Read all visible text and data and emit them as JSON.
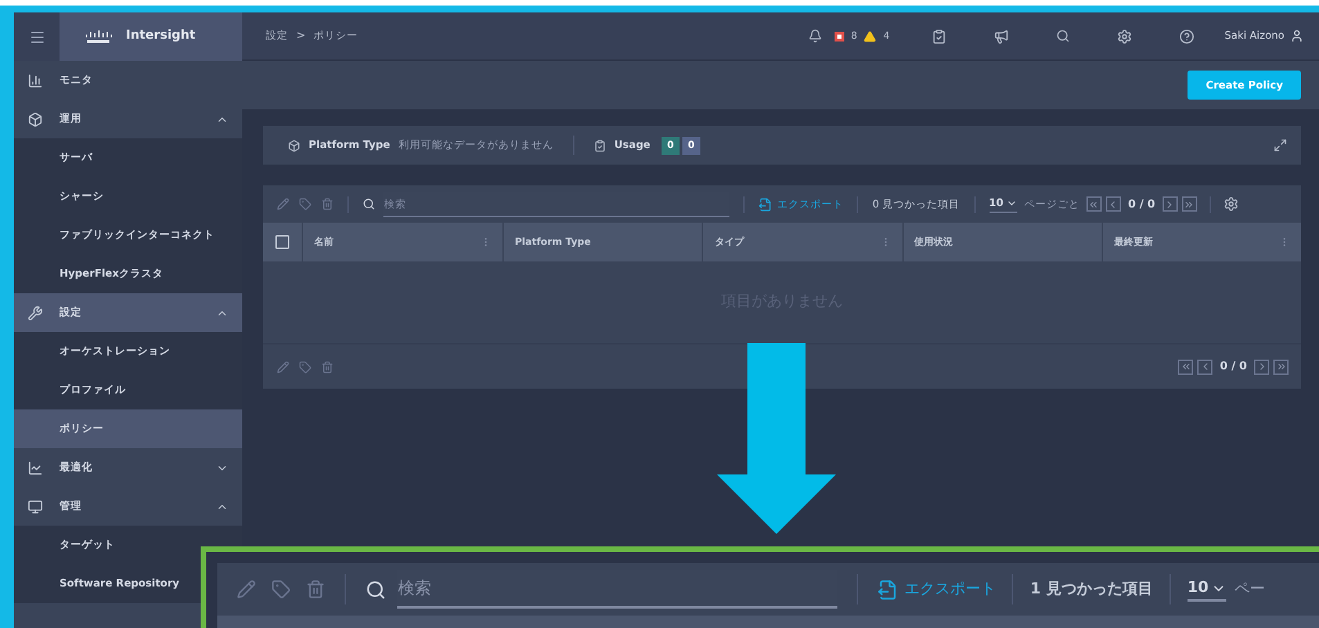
{
  "topbar": {
    "brand": "Intersight",
    "breadcrumb": [
      "設定",
      "ポリシー"
    ],
    "separator": ">",
    "critical_count": "8",
    "warning_count": "4",
    "user": "Saki Aizono"
  },
  "sidebar": {
    "items": [
      {
        "label": "モニタ",
        "selected": false
      },
      {
        "label": "運用",
        "selected": false,
        "expanded": true,
        "children": [
          {
            "label": "サーバ",
            "selected": false
          },
          {
            "label": "シャーシ",
            "selected": false
          },
          {
            "label": "ファブリックインターコネクト",
            "selected": false
          },
          {
            "label": "HyperFlexクラスタ",
            "selected": false
          }
        ]
      },
      {
        "label": "設定",
        "selected": true,
        "expanded": true,
        "children": [
          {
            "label": "オーケストレーション",
            "selected": false
          },
          {
            "label": "プロファイル",
            "selected": false
          },
          {
            "label": "ポリシー",
            "selected": true
          }
        ]
      },
      {
        "label": "最適化",
        "selected": false,
        "expanded": false
      },
      {
        "label": "管理",
        "selected": false,
        "expanded": true,
        "children": [
          {
            "label": "ターゲット",
            "selected": false
          },
          {
            "label": "Software Repository",
            "selected": false
          }
        ]
      }
    ]
  },
  "create_button": "Create Policy",
  "summary": {
    "platform_label": "Platform Type",
    "platform_value": "利用可能なデータがありません",
    "usage_label": "Usage",
    "usage_badges": [
      {
        "text": "0",
        "color": "#2f7a78"
      },
      {
        "text": "0",
        "color": "#56648a"
      }
    ]
  },
  "table": {
    "select_all_checked": false,
    "search_placeholder": "検索",
    "export": "エクスポート",
    "count": "0 見つかった項目",
    "page_size": "10",
    "per_page": "ページごと",
    "page": "0 / 0",
    "columns": [
      {
        "label": "名前",
        "menu": true
      },
      {
        "label": "Platform Type",
        "menu": false
      },
      {
        "label": "タイプ",
        "menu": true
      },
      {
        "label": "使用状況",
        "menu": false
      },
      {
        "label": "最終更新",
        "menu": true
      }
    ],
    "empty": "項目がありません",
    "footer_page": "0 / 0"
  },
  "inset": {
    "search_placeholder": "検索",
    "export": "エクスポート",
    "count": "1 見つかった項目",
    "page_size": "10",
    "per_page": "ペー"
  }
}
